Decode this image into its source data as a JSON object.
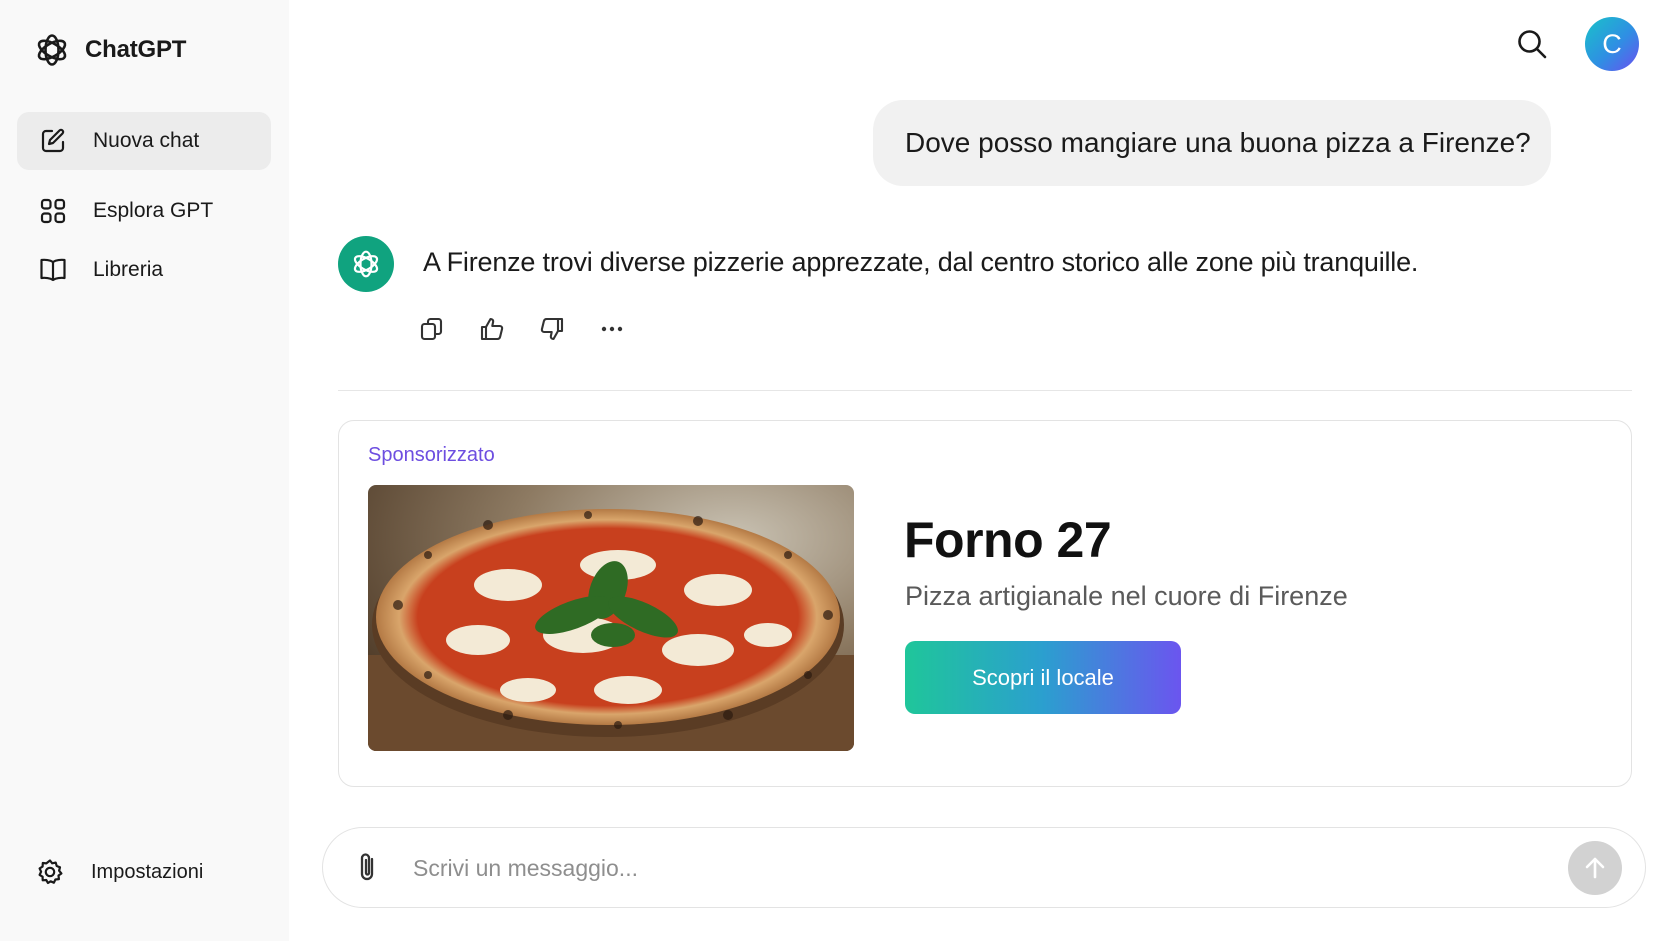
{
  "brand": {
    "name": "ChatGPT",
    "icon": "openai-logo-icon"
  },
  "sidebar": {
    "items": [
      {
        "label": "Nuova chat",
        "icon": "edit-icon",
        "active": true
      },
      {
        "label": "Esplora GPT",
        "icon": "grid-icon",
        "active": false
      },
      {
        "label": "Libreria",
        "icon": "book-icon",
        "active": false
      }
    ],
    "settings": {
      "label": "Impostazioni",
      "icon": "gear-icon"
    }
  },
  "header": {
    "search_icon": "search-icon",
    "avatar_initial": "C"
  },
  "conversation": {
    "user_message": "Dove posso mangiare una buona pizza a Firenze?",
    "assistant_message": "A Firenze trovi diverse pizzerie apprezzate, dal centro storico alle zone più tranquille.",
    "actions": [
      "copy-icon",
      "thumbs-up-icon",
      "thumbs-down-icon",
      "more-icon"
    ]
  },
  "ad": {
    "label": "Sponsorizzato",
    "title": "Forno 27",
    "subtitle": "Pizza artigianale nel cuore di Firenze",
    "cta": "Scopri il locale"
  },
  "composer": {
    "placeholder": "Scrivi un messaggio...",
    "value": ""
  },
  "colors": {
    "sidebar_bg": "#f9f9f9",
    "assistant_avatar": "#10a37f",
    "ad_label": "#6d4ee0",
    "cta_gradient_start": "#1fc69a",
    "cta_gradient_end": "#6b55ef"
  }
}
